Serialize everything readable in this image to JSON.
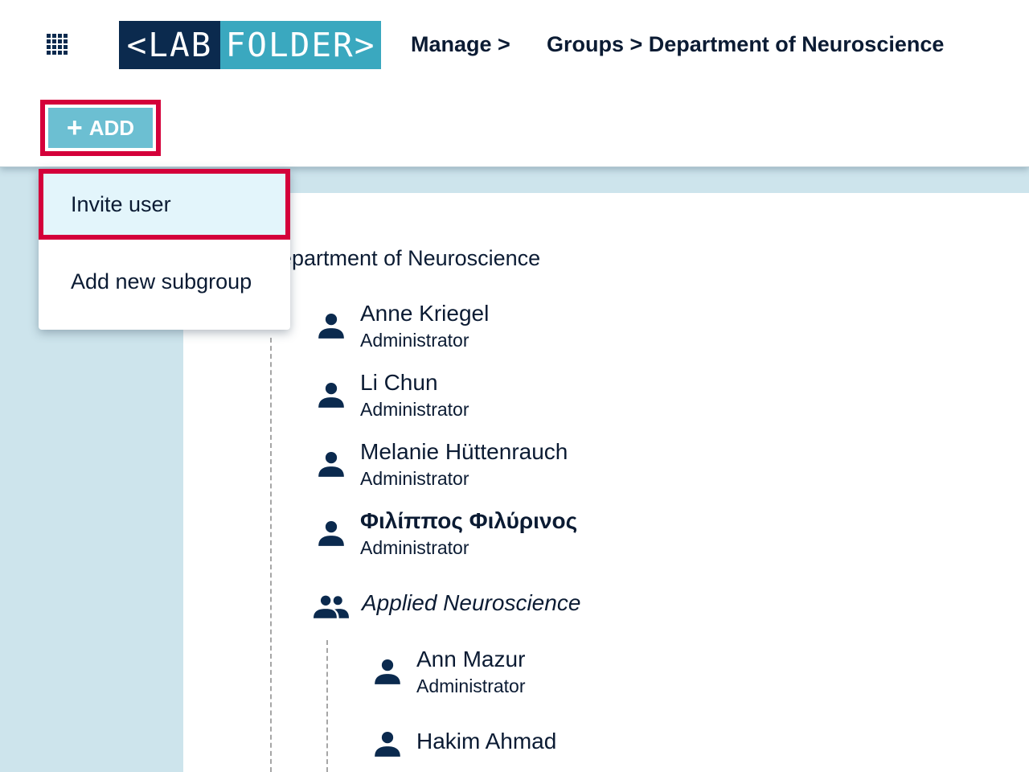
{
  "logo": {
    "left_text": "<LAB",
    "right_text": "FOLDER>"
  },
  "breadcrumb": {
    "manage": "Manage >",
    "groups": "Groups > Department of Neuroscience"
  },
  "toolbar": {
    "add_label": "ADD",
    "add_icon": "plus-icon"
  },
  "dropdown": {
    "items": [
      {
        "label": "Invite user"
      },
      {
        "label": "Add new subgroup"
      }
    ]
  },
  "group": {
    "title": "epartment of Neuroscience",
    "members": [
      {
        "name": "Anne Kriegel",
        "role": "Administrator"
      },
      {
        "name": "Li Chun",
        "role": "Administrator"
      },
      {
        "name": "Melanie Hüttenrauch",
        "role": "Administrator"
      },
      {
        "name": "Φιλίππος Φιλύρινος",
        "role": "Administrator"
      }
    ],
    "subgroup": {
      "name": "Applied Neuroscience",
      "members": [
        {
          "name": "Ann Mazur",
          "role": "Administrator"
        },
        {
          "name": "Hakim Ahmad"
        }
      ]
    }
  },
  "colors": {
    "brand_dark": "#0b2a4e",
    "brand_teal": "#3aa8bf",
    "add_button": "#6cbfd2",
    "highlight": "#d4003a",
    "panel_bg": "#cde4ec"
  }
}
